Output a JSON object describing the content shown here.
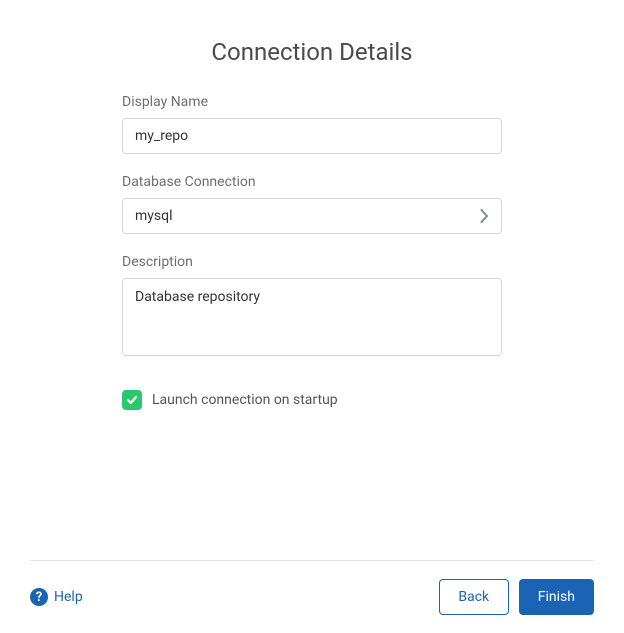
{
  "title": "Connection Details",
  "fields": {
    "displayName": {
      "label": "Display Name",
      "value": "my_repo"
    },
    "databaseConnection": {
      "label": "Database Connection",
      "value": "mysql"
    },
    "description": {
      "label": "Description",
      "value": "Database repository"
    }
  },
  "checkbox": {
    "checked": true,
    "label": "Launch connection on startup"
  },
  "footer": {
    "helpLabel": "Help",
    "backLabel": "Back",
    "finishLabel": "Finish"
  },
  "colors": {
    "primary": "#1a63b5",
    "checkboxGreen": "#2ac76d"
  }
}
